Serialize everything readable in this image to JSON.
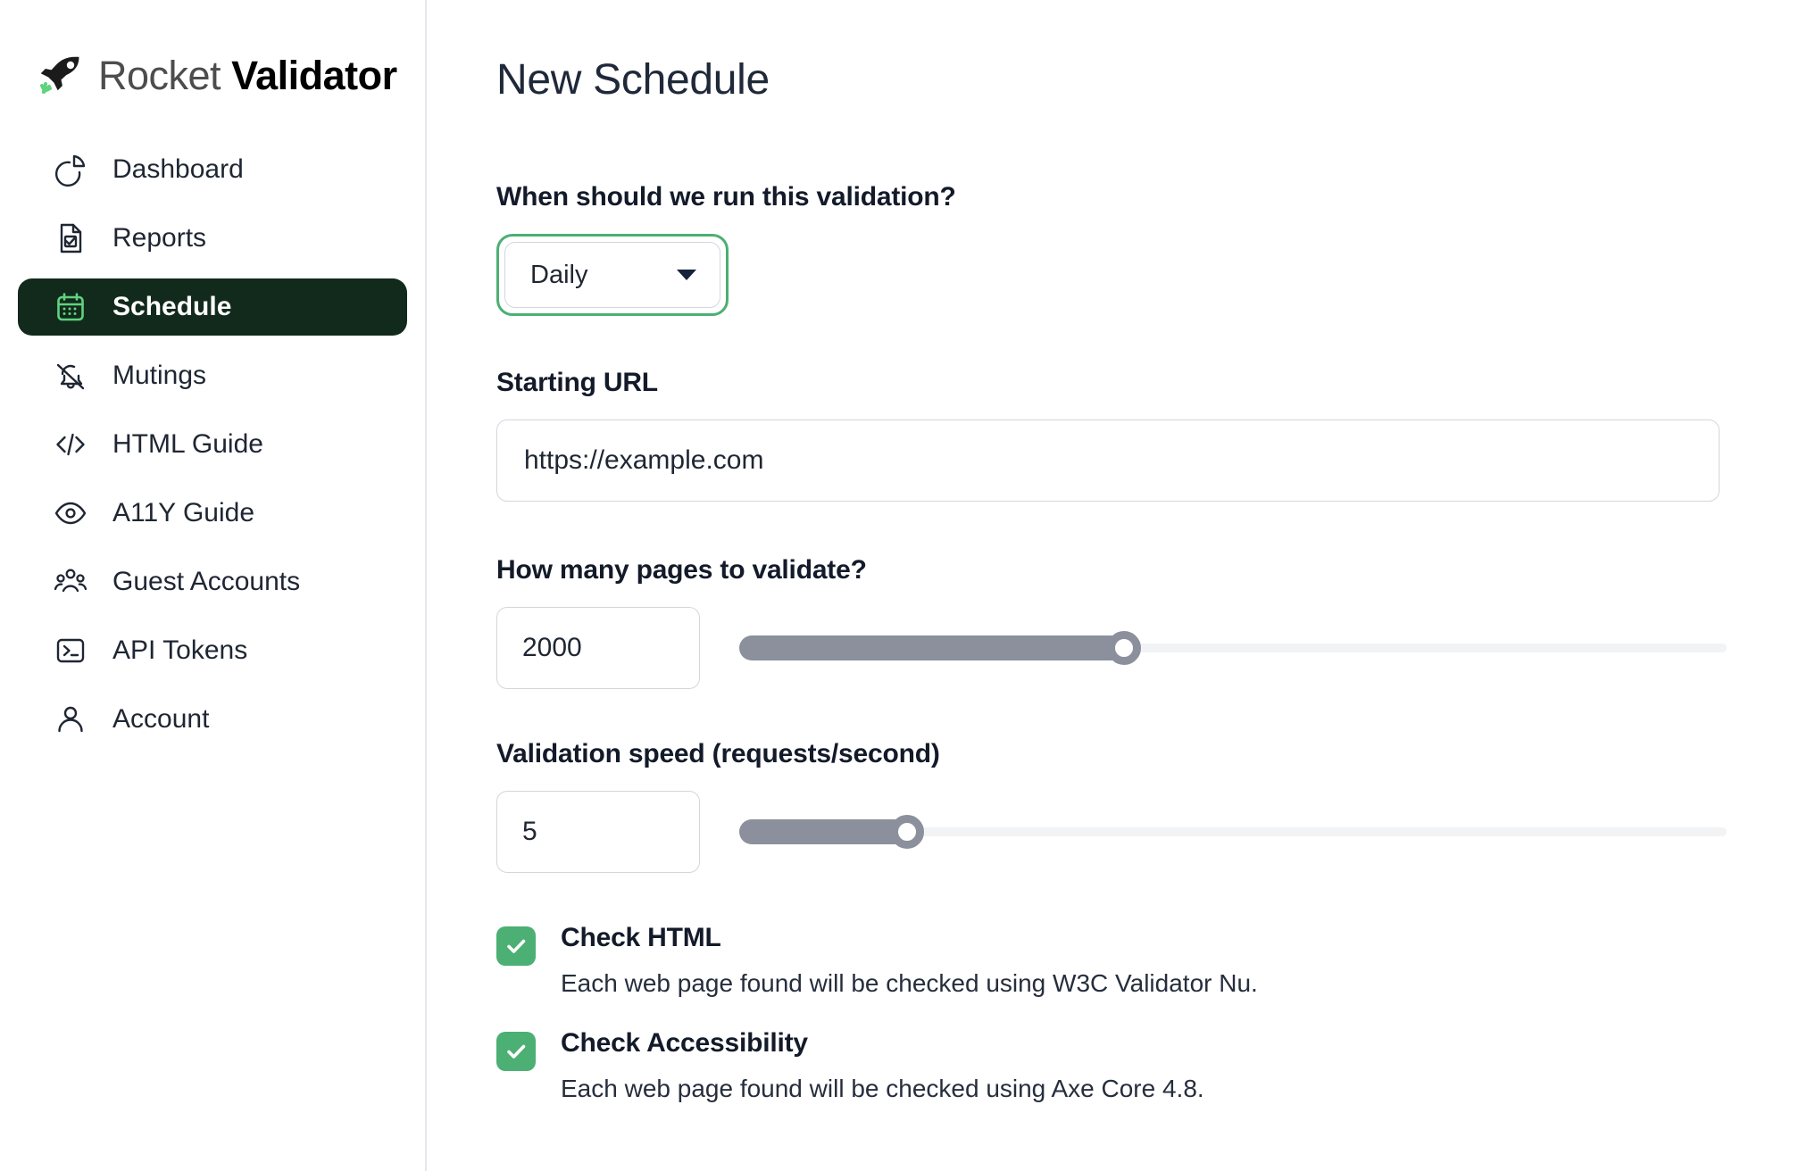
{
  "brand": {
    "name_light": "Rocket",
    "name_bold": "Validator",
    "icon": "rocket-check-icon"
  },
  "sidebar": {
    "items": [
      {
        "label": "Dashboard",
        "icon": "pie-chart-icon",
        "active": false
      },
      {
        "label": "Reports",
        "icon": "document-check-icon",
        "active": false
      },
      {
        "label": "Schedule",
        "icon": "calendar-icon",
        "active": true
      },
      {
        "label": "Mutings",
        "icon": "bell-off-icon",
        "active": false
      },
      {
        "label": "HTML Guide",
        "icon": "code-brackets-icon",
        "active": false
      },
      {
        "label": "A11Y Guide",
        "icon": "eye-icon",
        "active": false
      },
      {
        "label": "Guest Accounts",
        "icon": "users-group-icon",
        "active": false
      },
      {
        "label": "API Tokens",
        "icon": "terminal-icon",
        "active": false
      },
      {
        "label": "Account",
        "icon": "user-icon",
        "active": false
      }
    ]
  },
  "main": {
    "page_title": "New Schedule",
    "frequency": {
      "label": "When should we run this validation?",
      "value": "Daily",
      "options": [
        "Daily"
      ],
      "focused": true
    },
    "starting_url": {
      "label": "Starting URL",
      "value": "https://example.com",
      "placeholder": "https://example.com"
    },
    "pages": {
      "label": "How many pages to validate?",
      "value": "2000",
      "slider_percent": 39
    },
    "speed": {
      "label": "Validation speed (requests/second)",
      "value": "5",
      "slider_percent": 17
    },
    "checks": [
      {
        "title": "Check HTML",
        "description": "Each web page found will be checked using W3C Validator Nu.",
        "checked": true
      },
      {
        "title": "Check Accessibility",
        "description": "Each web page found will be checked using Axe Core 4.8.",
        "checked": true
      }
    ]
  },
  "colors": {
    "accent_green": "#4caf73",
    "active_nav_bg": "#122a1b",
    "active_nav_icon": "#5fd37f",
    "text_dark": "#131a29",
    "slider_fill": "#8b909c",
    "border": "#d3d6dd"
  }
}
